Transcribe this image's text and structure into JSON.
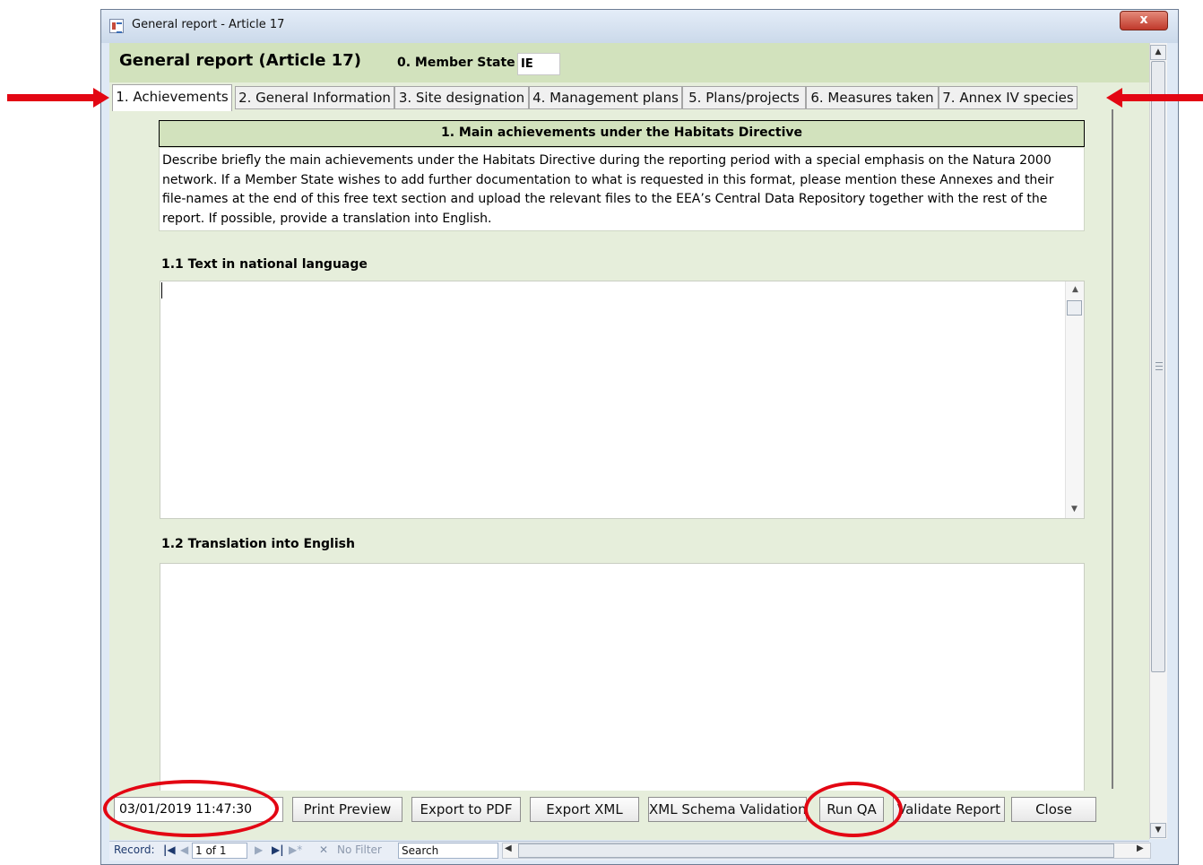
{
  "window": {
    "title": "General report - Article 17",
    "close_glyph": "x"
  },
  "header": {
    "title": "General report (Article 17)",
    "member_state_label": "0. Member State",
    "member_state_value": "IE"
  },
  "tabs": [
    {
      "label": "1. Achievements",
      "active": true
    },
    {
      "label": "2. General Information"
    },
    {
      "label": "3. Site designation"
    },
    {
      "label": "4. Management plans"
    },
    {
      "label": "5. Plans/projects"
    },
    {
      "label": "6. Measures taken"
    },
    {
      "label": "7. Annex IV species"
    }
  ],
  "section": {
    "heading": "1. Main achievements under the Habitats Directive",
    "description": "Describe briefly the main achievements under the Habitats Directive during the reporting period with a special emphasis on the Natura 2000 network. If a Member State wishes to add further documentation to what is requested in this format, please mention these Annexes and their file-names at the end of this free text section and upload the relevant files to the EEA’s Central Data Repository together with the rest of the report. If possible, provide a translation into English.",
    "field1_label": "1.1 Text in national language",
    "field1_value": "",
    "field2_label": "1.2 Translation into English",
    "field2_value": ""
  },
  "footer": {
    "timestamp": "03/01/2019 11:47:30",
    "buttons": {
      "print_preview": "Print Preview",
      "export_pdf": "Export to PDF",
      "export_xml": "Export XML",
      "xml_schema": "XML Schema Validation",
      "run_qa": "Run QA",
      "validate_report": "Validate Report",
      "close": "Close"
    }
  },
  "record_nav": {
    "label": "Record:",
    "current": "1 of 1",
    "no_filter": "No Filter",
    "search": "Search"
  },
  "icons": {
    "window_icon": "form-icon",
    "first": "first-record-icon",
    "prev": "prev-record-icon",
    "next": "next-record-icon",
    "last": "last-record-icon",
    "new": "new-record-icon",
    "filter": "filter-icon"
  },
  "colors": {
    "header_green": "#d2e2bd",
    "body_green": "#e6eedb",
    "annotation_red": "#e30613"
  }
}
